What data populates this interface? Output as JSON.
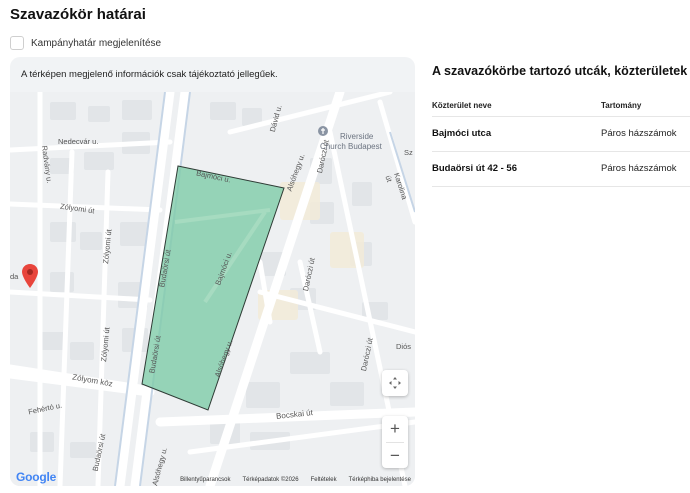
{
  "page": {
    "title": "Szavazókör határai"
  },
  "campaign_toggle": {
    "label": "Kampányhatár megjelenítése",
    "checked": false
  },
  "map": {
    "note": "A térképen megjelenő információk csak tájékoztató jellegűek.",
    "street_labels": [
      "Bajmóci u.",
      "Bajmóci u.",
      "Nedecvár u.",
      "Radvány u.",
      "Zólyomi út",
      "Zólyomi út",
      "Zólyomi út",
      "Zólyom köz",
      "Fehértó u.",
      "Budaörsi út",
      "Budaörsi út",
      "Budaörsi út",
      "Alsóhegy u.",
      "Alsóhegy u.",
      "Alsóhegy u.",
      "Dávid u.",
      "Daróczi út",
      "Daróczi út",
      "Daróczi út",
      "Karolina út",
      "Bocskai út",
      "Riverside",
      "Church Budapest",
      "Diós",
      "Sz",
      "da"
    ],
    "attribution": [
      "Billentyűparancsok",
      "Térképadatok ©2026",
      "Feltételek",
      "Térképhiba bejelentése"
    ],
    "logo_text": "Google",
    "controls": {
      "zoom_in": "+",
      "zoom_out": "−"
    },
    "colors": {
      "polygon_fill": "#7ccaa6",
      "polygon_stroke": "#2e3b35",
      "marker": "#e8453c",
      "roads": "#ffffff",
      "blocks": "#e8eaec",
      "accent_road": "#c5d4e6"
    }
  },
  "streets": {
    "title": "A szavazókörbe tartozó utcák, közterületek",
    "columns": [
      "Közterület neve",
      "Tartomány"
    ],
    "rows": [
      {
        "name": "Bajmóci utca",
        "range": "Páros házszámok"
      },
      {
        "name": "Budaörsi út 42 - 56",
        "range": "Páros házszámok"
      }
    ]
  }
}
